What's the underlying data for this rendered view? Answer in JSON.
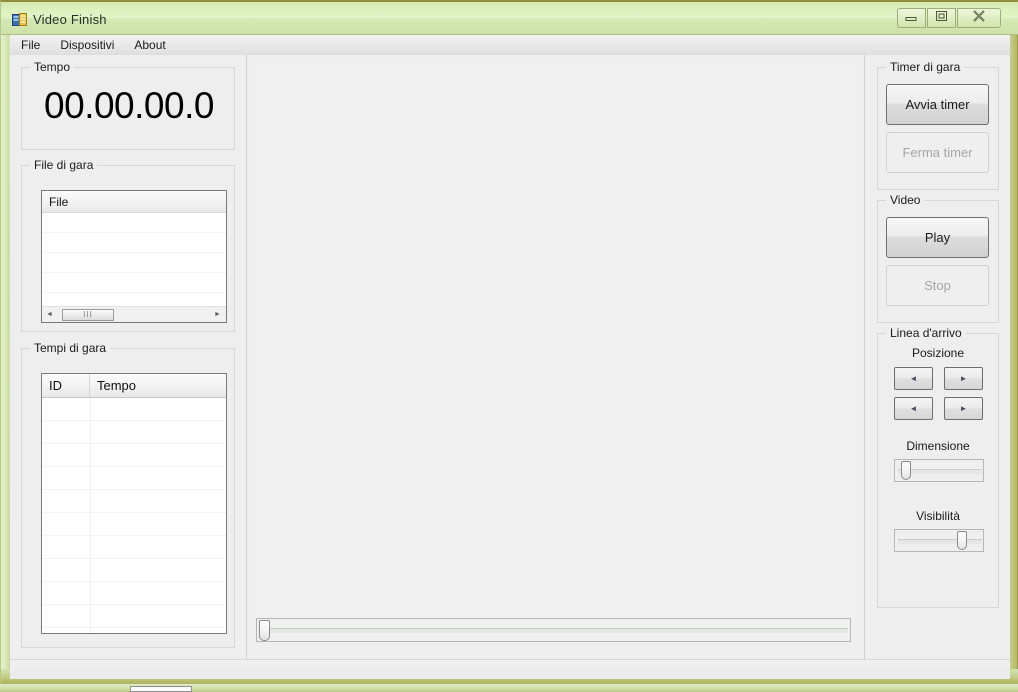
{
  "window": {
    "title": "Video Finish",
    "app_icon": "application-icon",
    "controls": {
      "minimize": "minimize-button",
      "maximize": "maximize-restore-button",
      "close": "close-button"
    }
  },
  "menubar": {
    "items": [
      {
        "label": "File"
      },
      {
        "label": "Dispositivi"
      },
      {
        "label": "About"
      }
    ]
  },
  "left_panel": {
    "tempo_group": {
      "label": "Tempo",
      "display": "00.00.00.0"
    },
    "file_group": {
      "label": "File di gara",
      "list": {
        "columns": [
          "File"
        ],
        "rows": [],
        "empty_row_count": 6,
        "hscroll": {
          "left_arrow": "◄",
          "right_arrow": "►",
          "grip": "III",
          "thumb_position_pct": 11
        }
      }
    },
    "tempi_group": {
      "label": "Tempi di gara",
      "grid": {
        "columns": [
          "ID",
          "Tempo"
        ],
        "rows": [],
        "empty_row_count": 11
      }
    }
  },
  "center": {
    "video_area_name": "video-preview",
    "position_trackbar": {
      "value_pct": 0,
      "min": 0,
      "max": 100
    }
  },
  "right_panel": {
    "timer_group": {
      "label": "Timer di gara",
      "start_button": {
        "label": "Avvia timer",
        "enabled": true
      },
      "stop_button": {
        "label": "Ferma timer",
        "enabled": false
      }
    },
    "video_group": {
      "label": "Video",
      "play_button": {
        "label": "Play",
        "enabled": true
      },
      "stop_button": {
        "label": "Stop",
        "enabled": false
      }
    },
    "finish_line_group": {
      "label": "Linea d'arrivo",
      "position_label": "Posizione",
      "position_buttons": {
        "left_1": "◄",
        "right_1": "►",
        "left_2": "◄",
        "right_2": "►"
      },
      "size_label": "Dimensione",
      "size_slider": {
        "value_pct": 6,
        "min": 0,
        "max": 100
      },
      "visibility_label": "Visibilità",
      "visibility_slider": {
        "value_pct": 72,
        "min": 0,
        "max": 100
      }
    }
  },
  "statusbar": {
    "text": ""
  },
  "colors": {
    "title_bar_green": "#d9e8b8",
    "frame_olive": "#8f8c3c",
    "panel_gray": "#eeeeee",
    "canvas_gray": "#f0f0f0",
    "button_border": "#707070",
    "disabled_text": "#a6a6a6"
  }
}
